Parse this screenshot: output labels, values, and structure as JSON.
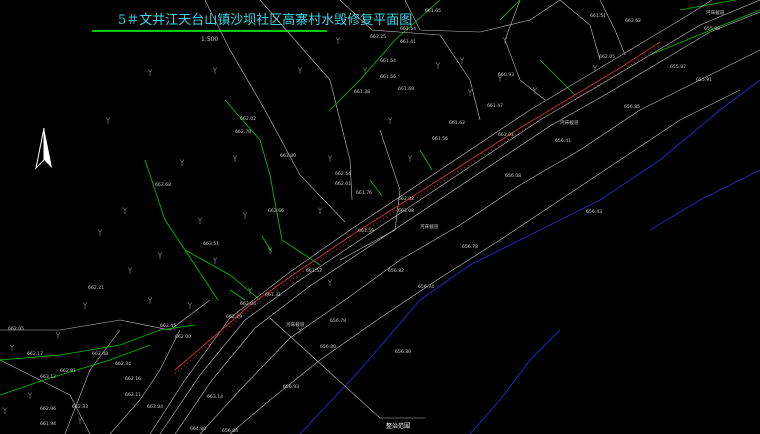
{
  "title": "5＃文井江天台山镇沙坝社区高寨村水毁修复平面图",
  "scale": "1:500",
  "north_arrow": "north-arrow-icon",
  "callout": "整治范围",
  "water_labels": [
    "河床截道",
    "河床截道",
    "河床截道",
    "河床截道"
  ],
  "elevations": [
    "661.65",
    "661.51",
    "663.25",
    "661.54",
    "661.41",
    "661.54",
    "663.62",
    "661.56",
    "660.93",
    "661.68",
    "661.38",
    "661.47",
    "661.62",
    "662.05",
    "662.01",
    "661.56",
    "662.54",
    "662.01",
    "661.76",
    "662.02",
    "662.68",
    "662.66",
    "662.02",
    "662.78",
    "663.51",
    "663.80",
    "661.59",
    "661.52",
    "661.31",
    "663.08",
    "662.04",
    "662.29",
    "662.45",
    "662.00",
    "662.21",
    "662.48",
    "662.81",
    "663.12",
    "662.17",
    "662.05",
    "662.34",
    "662.16",
    "663.11",
    "663.84",
    "664.80",
    "663.14",
    "662.33",
    "662.96",
    "661.94",
    "655.87",
    "655.99",
    "655.91",
    "656.85",
    "656.41",
    "656.08",
    "656.43",
    "656.78",
    "656.82",
    "656.74",
    "656.78",
    "656.80",
    "656.93",
    "656.80",
    "656.84"
  ],
  "colors": {
    "title": "#3ad6e6",
    "title_rule": "#00c800",
    "contour": "#00c800",
    "road": "#bfbfbf",
    "river": "#1a2fd0",
    "revetment": "#d23030"
  }
}
